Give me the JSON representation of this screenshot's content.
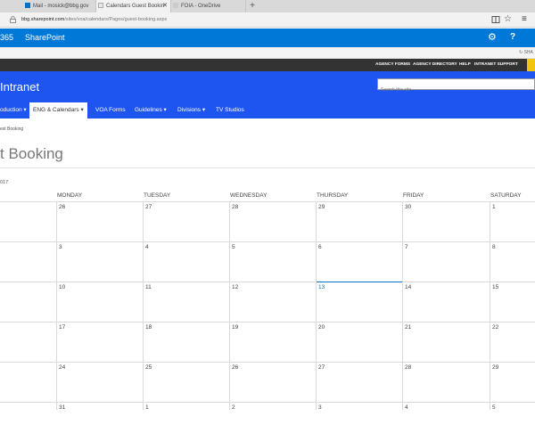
{
  "browser": {
    "tabs": [
      {
        "label": "Mail - mosick@bbg.gov",
        "active": false
      },
      {
        "label": "Calendars Guest Bookin",
        "active": true
      },
      {
        "label": "FOIA - OneDrive",
        "active": false
      }
    ],
    "new_tab": "+",
    "url_domain": "bbg.sharepoint.com",
    "url_path": "/sites/voa/calendars/Pages/guest-booking.aspx",
    "url_prefix": ""
  },
  "suitebar": {
    "product": "365",
    "app": "SharePoint",
    "gear": "⚙",
    "help": "?"
  },
  "share_strip": {
    "share_label": "SHA"
  },
  "top_links": [
    "AGENCY FORMS",
    "AGENCY DIRECTORY",
    "HELP",
    "INTRANET SUPPORT"
  ],
  "site": {
    "title": "Intranet",
    "search_placeholder": "Search this site"
  },
  "nav": [
    {
      "label": "oduction",
      "arrow": "▾",
      "selected": false
    },
    {
      "label": "ENG & Calendars",
      "arrow": "▾",
      "selected": true
    },
    {
      "label": "VOA Forms",
      "arrow": "",
      "selected": false
    },
    {
      "label": "Guidelines",
      "arrow": "▾",
      "selected": false
    },
    {
      "label": "Divisions",
      "arrow": "▾",
      "selected": false
    },
    {
      "label": "TV Studios",
      "arrow": "",
      "selected": false
    }
  ],
  "breadcrumb": "est Booking",
  "page_title": "t Booking",
  "month_label": "017",
  "calendar": {
    "days": [
      "MONDAY",
      "TUESDAY",
      "WEDNESDAY",
      "THURSDAY",
      "FRIDAY",
      "SATURDAY"
    ],
    "weeks": [
      [
        "26",
        "27",
        "28",
        "29",
        "30",
        "1"
      ],
      [
        "3",
        "4",
        "5",
        "6",
        "7",
        "8"
      ],
      [
        "10",
        "11",
        "12",
        "13",
        "14",
        "15"
      ],
      [
        "17",
        "18",
        "19",
        "20",
        "21",
        "22"
      ],
      [
        "24",
        "25",
        "26",
        "27",
        "28",
        "29"
      ],
      [
        "31",
        "1",
        "2",
        "3",
        "4",
        "5"
      ]
    ],
    "today": "13"
  },
  "colors": {
    "suite_blue": "#0078d7",
    "header_blue": "#1e55f0",
    "today_blue": "#0072c6",
    "dark_bar": "#333333",
    "accent_yellow": "#f1c40f"
  }
}
